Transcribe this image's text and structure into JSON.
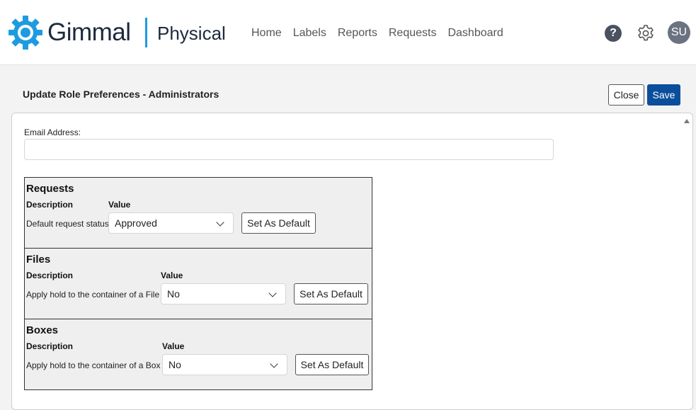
{
  "header": {
    "brand": "Gimmal",
    "product": "Physical",
    "nav": [
      "Home",
      "Labels",
      "Reports",
      "Requests",
      "Dashboard"
    ],
    "help_glyph": "?",
    "avatar_initials": "SU",
    "icons": [
      "gear-logo-icon",
      "help-icon",
      "gear-icon"
    ],
    "colors": {
      "brand_blue": "#1e9be0",
      "save_blue": "#0b4f9c"
    }
  },
  "page": {
    "title": "Update Role Preferences - Administrators",
    "close_label": "Close",
    "save_label": "Save"
  },
  "email": {
    "label": "Email Address:",
    "value": "",
    "placeholder": ""
  },
  "sections": [
    {
      "title": "Requests",
      "col_description": "Description",
      "col_value": "Value",
      "row_description": "Default request status",
      "value": "Approved",
      "button": "Set As Default"
    },
    {
      "title": "Files",
      "col_description": "Description",
      "col_value": "Value",
      "row_description": "Apply hold to the container of a File",
      "value": "No",
      "button": "Set As Default"
    },
    {
      "title": "Boxes",
      "col_description": "Description",
      "col_value": "Value",
      "row_description": "Apply hold to the container of a Box",
      "value": "No",
      "button": "Set As Default"
    }
  ]
}
